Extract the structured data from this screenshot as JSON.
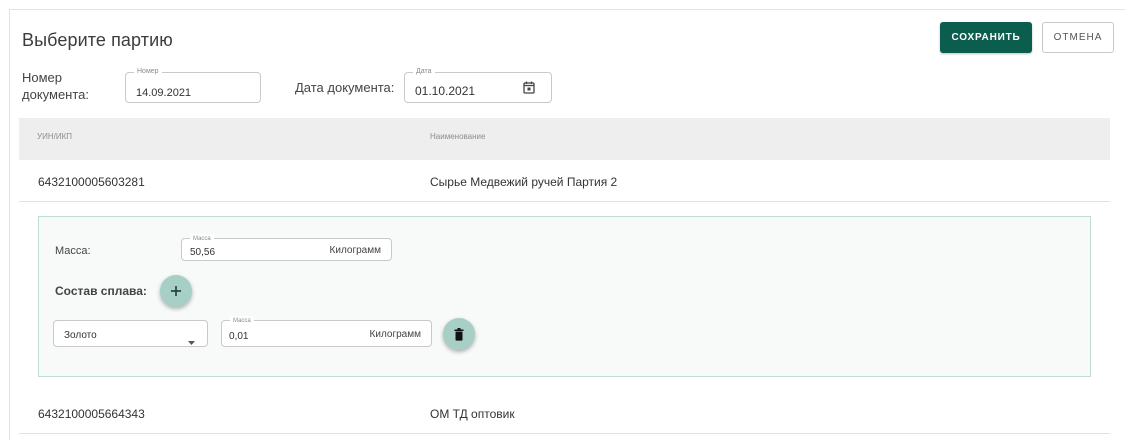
{
  "header": {
    "title": "Выберите партию",
    "save_label": "СОХРАНИТЬ",
    "cancel_label": "ОТМЕНА"
  },
  "filters": {
    "doc_number_label_line1": "Номер",
    "doc_number_label_line2": "документа:",
    "doc_number_floating": "Номер",
    "doc_number_value": "14.09.2021",
    "doc_date_label": "Дата документа:",
    "doc_date_floating": "Дата",
    "doc_date_value": "01.10.2021"
  },
  "table": {
    "columns": [
      "УИН/ИКП",
      "Наименование"
    ],
    "rows": [
      {
        "uin": "6432100005603281",
        "name": "Сырье Медвежий ручей Партия 2"
      },
      {
        "uin": "6432100005664343",
        "name": "ОМ ТД оптовик"
      }
    ]
  },
  "detail": {
    "mass_label": "Масса:",
    "mass_floating": "Масса",
    "mass_value": "50,56",
    "mass_unit": "Килограмм",
    "alloy_label": "Состав сплава:",
    "alloy_items": [
      {
        "metal": "Золото",
        "mass_floating": "Масса",
        "mass_value": "0,01",
        "mass_unit": "Килограмм"
      }
    ]
  },
  "colors": {
    "primary": "#0b5e4e",
    "fab": "#a8cfc6",
    "panel_border": "#bfdcd6"
  },
  "icons": [
    "calendar-icon",
    "plus-icon",
    "dropdown-arrow-icon",
    "trash-icon"
  ]
}
